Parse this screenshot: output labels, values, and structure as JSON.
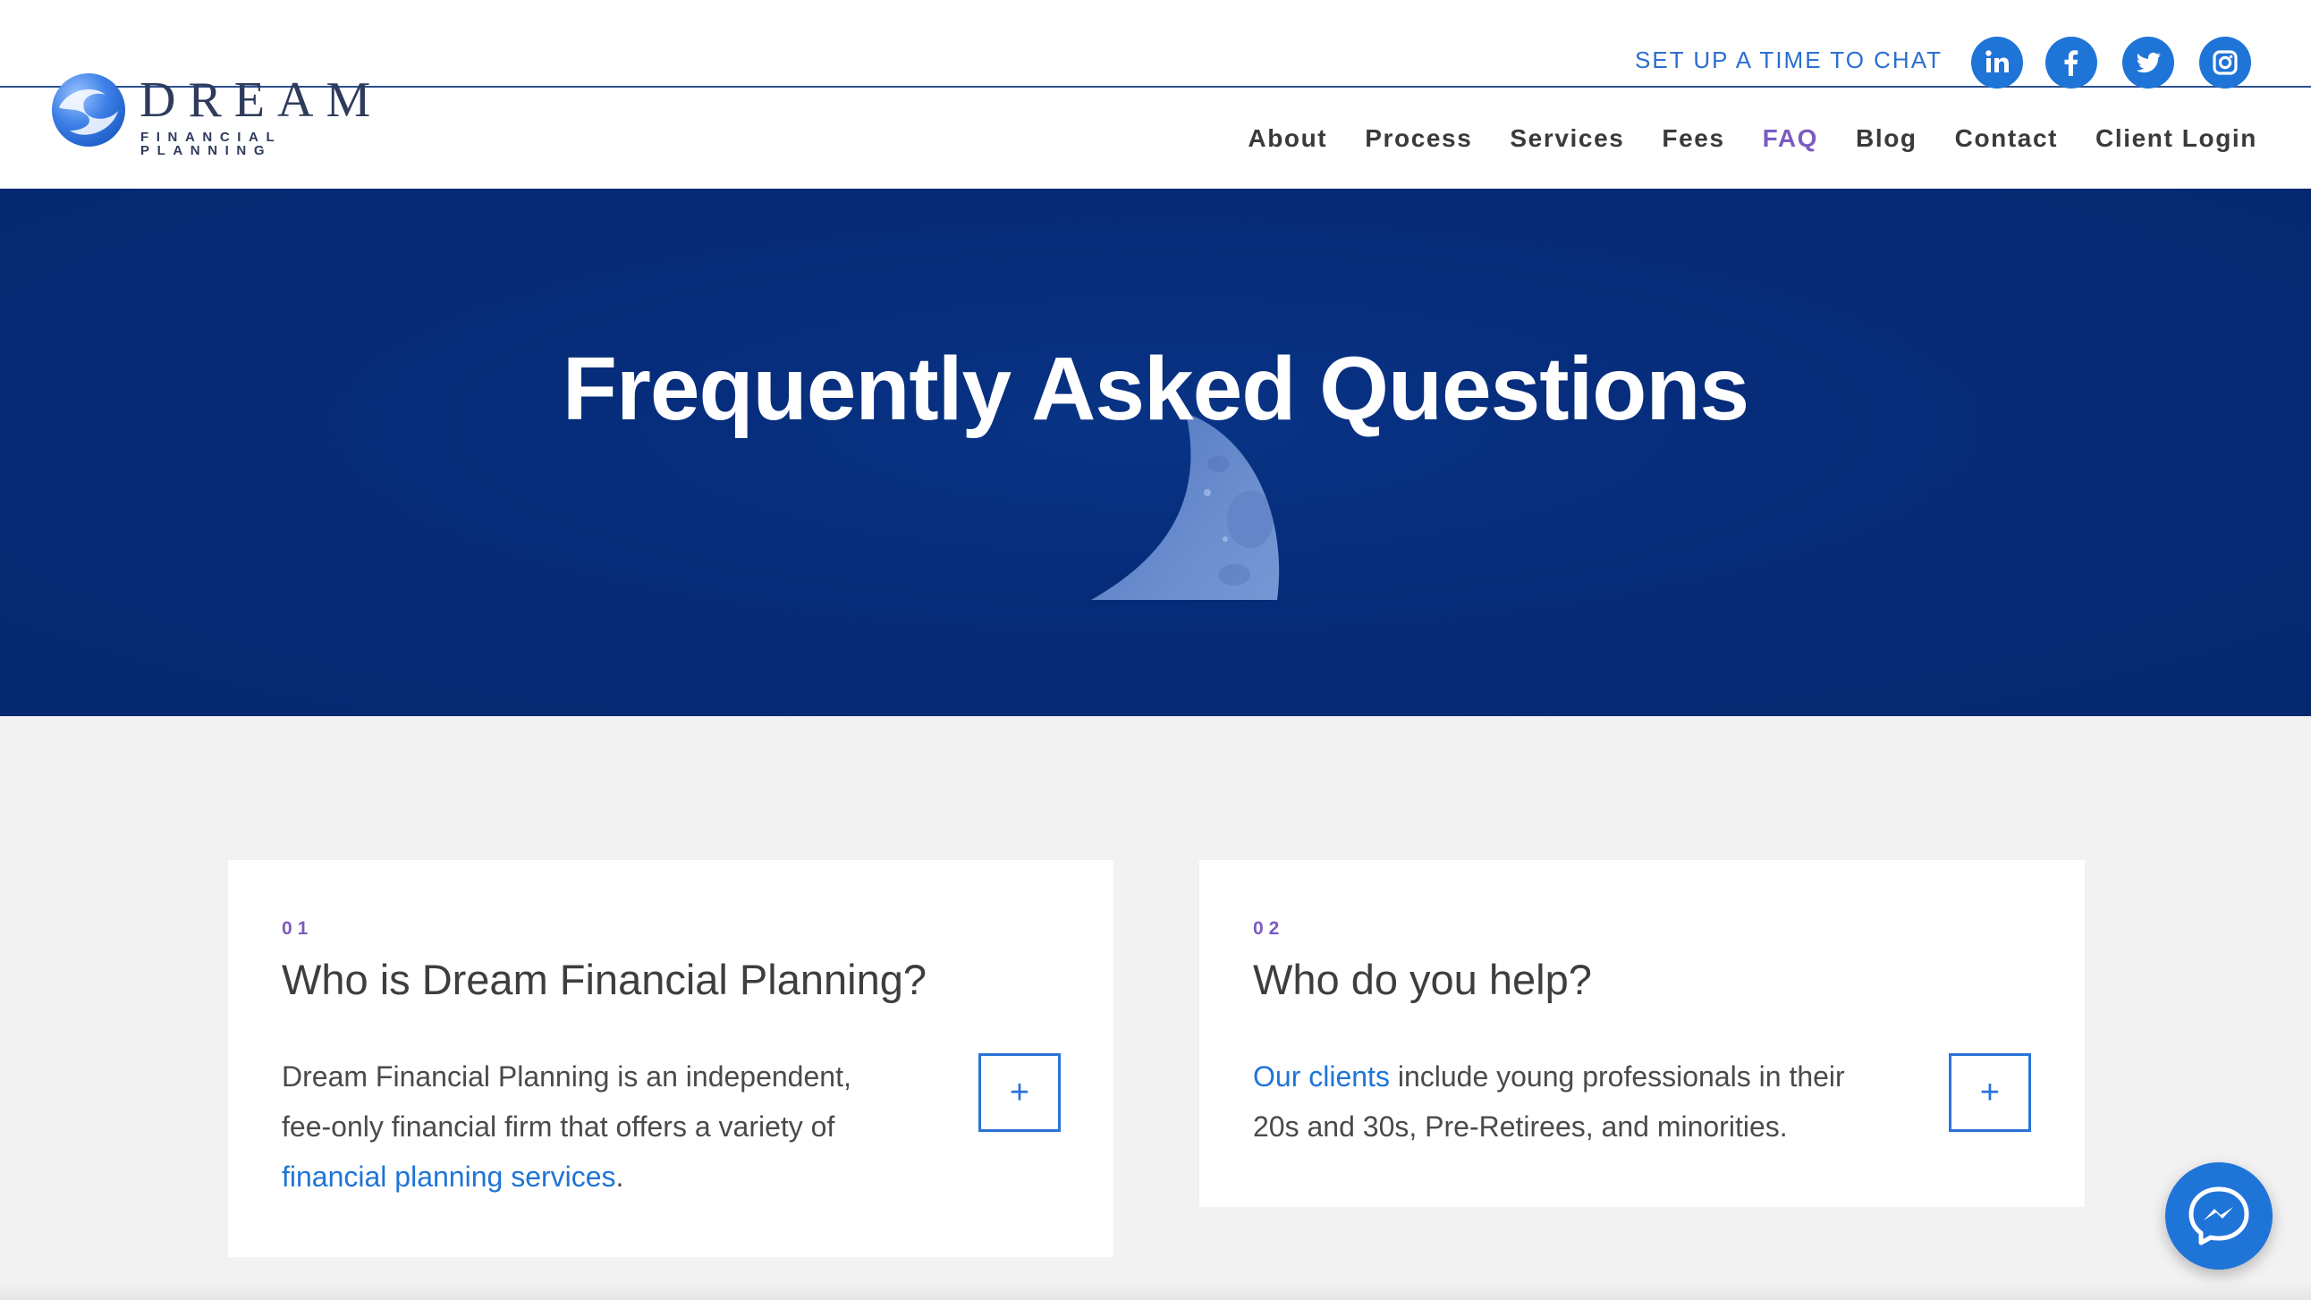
{
  "header": {
    "logo": {
      "word": "DREAM",
      "sub": "FINANCIAL PLANNING"
    },
    "chat_link": "SET UP A TIME TO CHAT",
    "social_icons": [
      "linkedin-icon",
      "facebook-icon",
      "twitter-icon",
      "instagram-icon"
    ],
    "nav": [
      {
        "label": "About",
        "active": false
      },
      {
        "label": "Process",
        "active": false
      },
      {
        "label": "Services",
        "active": false
      },
      {
        "label": "Fees",
        "active": false
      },
      {
        "label": "FAQ",
        "active": true
      },
      {
        "label": "Blog",
        "active": false
      },
      {
        "label": "Contact",
        "active": false
      },
      {
        "label": "Client Login",
        "active": false
      }
    ]
  },
  "hero": {
    "title": "Frequently Asked Questions"
  },
  "faq": [
    {
      "number": "01",
      "question": "Who is Dream Financial Planning?",
      "answer_before": "Dream Financial Planning is an independent, fee-only financial firm that offers a variety of ",
      "answer_link": "financial planning services",
      "answer_after": ".",
      "toggle": "+"
    },
    {
      "number": "02",
      "question": "Who do you help?",
      "answer_before": "",
      "answer_link": "Our clients",
      "answer_after": " include young professionals in their 20s and 30s, Pre-Retirees, and minorities.",
      "toggle": "+"
    }
  ],
  "colors": {
    "accent_blue": "#1f74d8",
    "active_purple": "#7a5cbf",
    "hero_navy": "#062b78"
  },
  "chat_widget": {
    "icon": "messenger-icon"
  }
}
